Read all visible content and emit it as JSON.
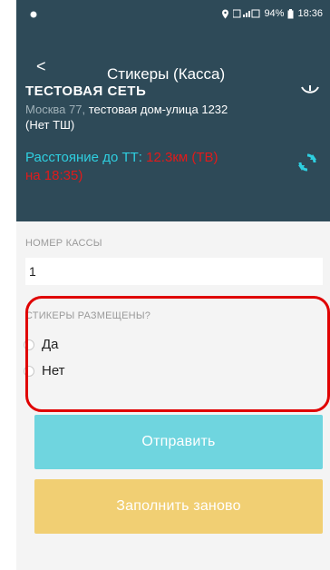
{
  "statusbar": {
    "right_text": "94%",
    "time": "18:36"
  },
  "header": {
    "back_glyph": "<",
    "title": "Стикеры (Касса)"
  },
  "store": {
    "network_name": "ТЕСТОВАЯ СЕТЬ",
    "address_city": "Москва 77,",
    "address_rest": " тестовая дом-улица 1232",
    "address_line2": "(Нет ТШ)",
    "distance_label": "Расстояние до ТТ: ",
    "distance_value": "12.3км (ТВ)",
    "distance_value2": "на 18:35)"
  },
  "form": {
    "kassa_label": "НОМЕР КАССЫ",
    "kassa_value": "1",
    "stickers_label": "СТИКЕРЫ РАЗМЕЩЕНЫ?",
    "option_yes": "Да",
    "option_no": "Нет"
  },
  "buttons": {
    "send": "Отправить",
    "refill": "Заполнить заново"
  },
  "colors": {
    "header_bg": "#2e4a58",
    "accent_cyan": "#2ecfe0",
    "send_btn": "#6fd5df",
    "refill_btn": "#f1cf73",
    "highlight": "#e00000"
  }
}
